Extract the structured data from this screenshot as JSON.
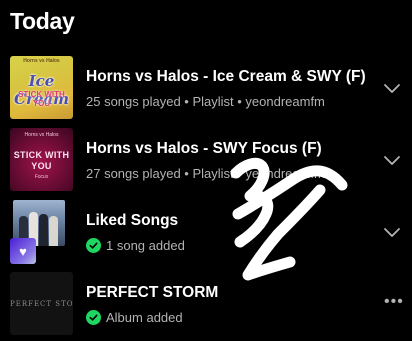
{
  "section": {
    "title": "Today"
  },
  "rows": [
    {
      "title": "Horns vs Halos - Ice Cream & SWY (F)",
      "meta": "25 songs played • Playlist • yeondreamfm",
      "cover": {
        "top": "Horns vs Halos",
        "big": "Ice Cream",
        "sub": "STICK WITH YOU"
      }
    },
    {
      "title": "Horns vs Halos - SWY Focus (F)",
      "meta": "27 songs played • Playlist • yeondreamfm",
      "cover": {
        "top": "Horns vs Halos",
        "big": "STICK WITH YOU",
        "sub": "Focus"
      }
    },
    {
      "title": "Liked Songs",
      "meta": "1 song added"
    },
    {
      "title": "PERFECT STORM",
      "meta": "Album added",
      "cover": {
        "text": "PERFECT STORM"
      }
    }
  ],
  "colors": {
    "accent": "#1ed760",
    "muted": "#b3b3b3",
    "background": "#000000"
  },
  "icons": [
    "chevron-down-icon",
    "chevron-down-icon",
    "chevron-down-icon",
    "more-options-icon",
    "check-circle-icon",
    "heart-icon"
  ]
}
